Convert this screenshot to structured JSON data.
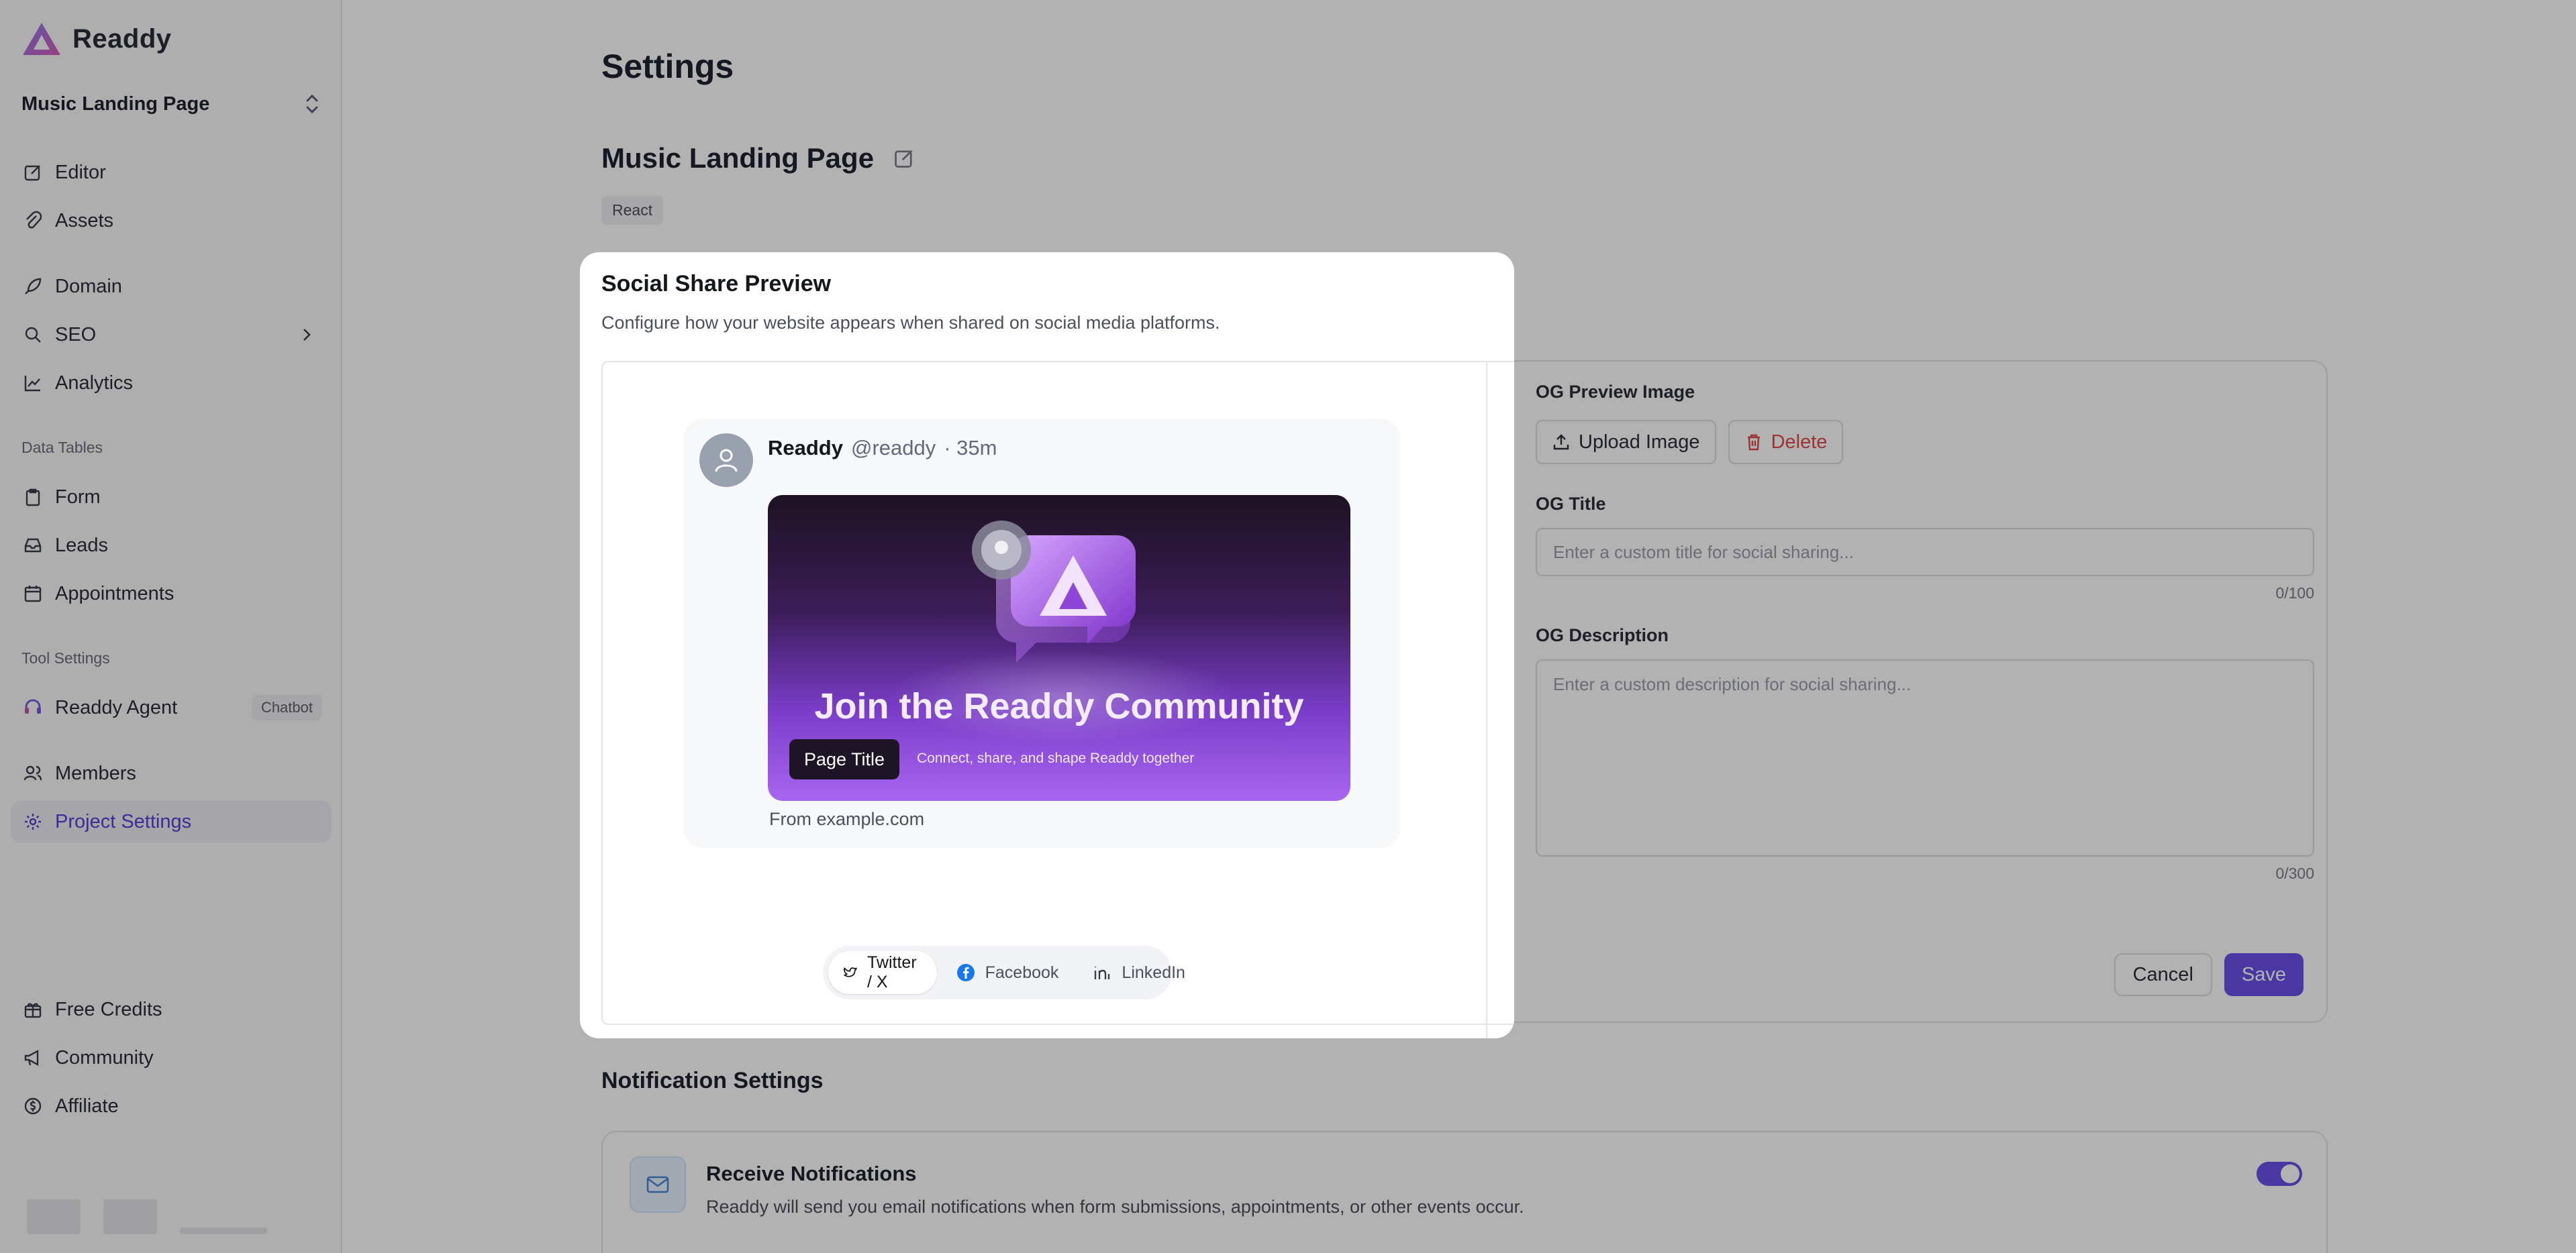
{
  "brand": {
    "name": "Readdy",
    "accent": "#6b4fe8"
  },
  "sidebar": {
    "project": "Music Landing Page",
    "items": [
      {
        "label": "Editor",
        "icon": "edit-icon"
      },
      {
        "label": "Assets",
        "icon": "paperclip-icon"
      },
      {
        "label": "Domain",
        "icon": "rocket-icon"
      },
      {
        "label": "SEO",
        "icon": "seo-icon"
      },
      {
        "label": "Analytics",
        "icon": "chart-line-icon"
      }
    ],
    "data_tables_label": "Data Tables",
    "data_tables": [
      {
        "label": "Form",
        "icon": "clipboard-icon"
      },
      {
        "label": "Leads",
        "icon": "inbox-icon"
      },
      {
        "label": "Appointments",
        "icon": "calendar-icon"
      }
    ],
    "tool_settings_label": "Tool Settings",
    "agent": {
      "label": "Readdy Agent",
      "badge": "Chatbot"
    },
    "members": "Members",
    "project_settings": "Project Settings",
    "bottom": [
      {
        "label": "Free Credits",
        "icon": "gift-icon"
      },
      {
        "label": "Community",
        "icon": "megaphone-icon"
      },
      {
        "label": "Affiliate",
        "icon": "dollar-icon"
      }
    ]
  },
  "main": {
    "title": "Settings",
    "project_name": "Music Landing Page",
    "tech_tag": "React",
    "og": {
      "image_label": "OG Preview Image",
      "upload": "Upload Image",
      "delete": "Delete",
      "title_label": "OG Title",
      "title_placeholder": "Enter a custom title for social sharing...",
      "title_counter": "0/100",
      "desc_label": "OG Description",
      "desc_placeholder": "Enter a custom description for social sharing...",
      "desc_counter": "0/300",
      "cancel": "Cancel",
      "save": "Save"
    },
    "notifications": {
      "title": "Notification Settings",
      "heading": "Receive Notifications",
      "description": "Readdy will send you email notifications when form submissions, appointments, or other events occur."
    }
  },
  "modal": {
    "title": "Social Share Preview",
    "subtitle": "Configure how your website appears when shared on social media platforms.",
    "post": {
      "name": "Readdy",
      "handle": "@readdy",
      "time": "· 35m",
      "headline": "Join the Readdy Community",
      "pill": "Page Title",
      "tagline": "Connect, share, and shape Readdy together",
      "from": "From example.com"
    },
    "tabs": [
      {
        "label": "Twitter / X",
        "icon": "twitter-icon"
      },
      {
        "label": "Facebook",
        "icon": "facebook-icon"
      },
      {
        "label": "LinkedIn",
        "icon": "linkedin-icon"
      }
    ]
  }
}
